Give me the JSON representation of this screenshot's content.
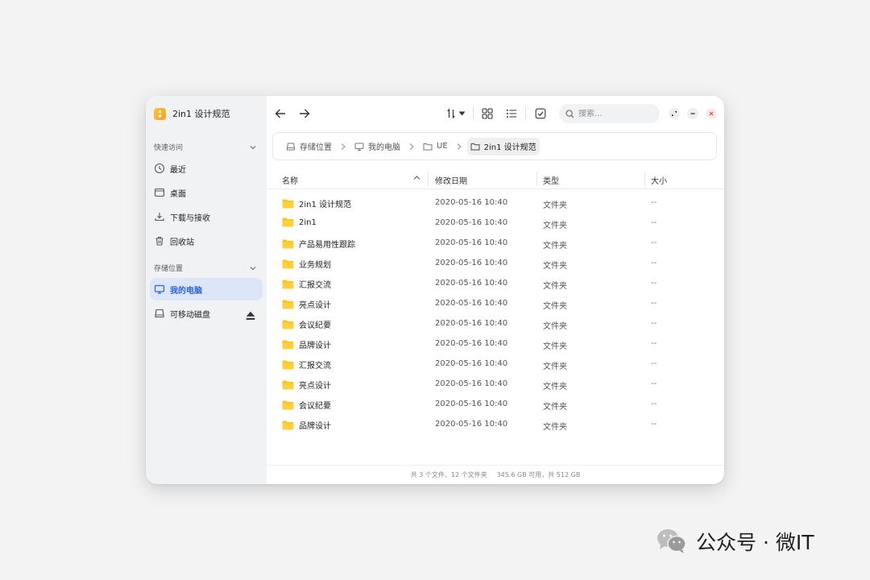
{
  "app": {
    "title": "2in1 设计规范"
  },
  "sidebar": {
    "quick_access": {
      "title": "快速访问",
      "items": [
        {
          "label": "最近",
          "icon": "clock-icon"
        },
        {
          "label": "桌面",
          "icon": "desktop-icon"
        },
        {
          "label": "下载与接收",
          "icon": "download-icon"
        },
        {
          "label": "回收站",
          "icon": "trash-icon"
        }
      ]
    },
    "storage": {
      "title": "存储位置",
      "items": [
        {
          "label": "我的电脑",
          "icon": "monitor-icon",
          "active": true
        },
        {
          "label": "可移动磁盘",
          "icon": "drive-icon"
        }
      ]
    }
  },
  "toolbar": {
    "search_placeholder": "搜索..."
  },
  "breadcrumb": [
    {
      "label": "存储位置",
      "icon": "drive-icon"
    },
    {
      "label": "我的电脑",
      "icon": "monitor-icon"
    },
    {
      "label": "UE",
      "icon": "folder-outline-icon"
    },
    {
      "label": "2in1 设计规范",
      "icon": "folder-outline-icon"
    }
  ],
  "table": {
    "headers": {
      "name": "名称",
      "date": "修改日期",
      "type": "类型",
      "size": "大小"
    },
    "rows": [
      {
        "name": "2in1 设计规范",
        "date": "2020-05-16  10:40",
        "type": "文件夹",
        "size": "--"
      },
      {
        "name": "2in1",
        "date": "2020-05-16  10:40",
        "type": "文件夹",
        "size": "--"
      },
      {
        "name": "产品易用性跟踪",
        "date": "2020-05-16  10:40",
        "type": "文件夹",
        "size": "--"
      },
      {
        "name": "业务规划",
        "date": "2020-05-16  10:40",
        "type": "文件夹",
        "size": "--"
      },
      {
        "name": "汇报交流",
        "date": "2020-05-16  10:40",
        "type": "文件夹",
        "size": "--"
      },
      {
        "name": "亮点设计",
        "date": "2020-05-16  10:40",
        "type": "文件夹",
        "size": "--"
      },
      {
        "name": "会议纪要",
        "date": "2020-05-16  10:40",
        "type": "文件夹",
        "size": "--"
      },
      {
        "name": "品牌设计",
        "date": "2020-05-16  10:40",
        "type": "文件夹",
        "size": "--"
      },
      {
        "name": "汇报交流",
        "date": "2020-05-16  10:40",
        "type": "文件夹",
        "size": "--"
      },
      {
        "name": "亮点设计",
        "date": "2020-05-16  10:40",
        "type": "文件夹",
        "size": "--"
      },
      {
        "name": "会议纪要",
        "date": "2020-05-16  10:40",
        "type": "文件夹",
        "size": "--"
      },
      {
        "name": "品牌设计",
        "date": "2020-05-16  10:40",
        "type": "文件夹",
        "size": "--"
      }
    ]
  },
  "status": {
    "counts": "共 3 个文件、12 个文件夹",
    "space": "345.6 GB 可用，共 512 GB"
  },
  "watermark": {
    "text": "公众号 · 微IT"
  },
  "colors": {
    "accent": "#2b63d9",
    "folder": "#ffc21f",
    "close": "#e84a4a"
  }
}
